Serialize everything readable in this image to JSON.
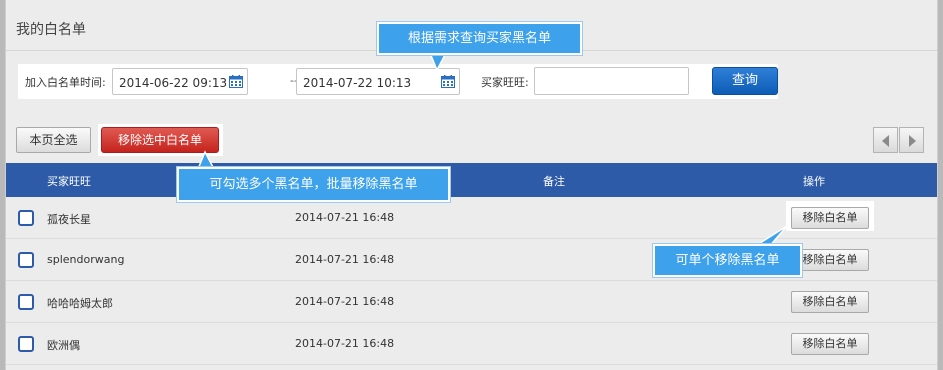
{
  "page_title": "我的白名单",
  "filter": {
    "date_label": "加入白名单时间:",
    "start_date": "2014-06-22 09:13",
    "separator": "--",
    "end_date": "2014-07-22 10:13",
    "buyer_label": "买家旺旺:",
    "buyer_value": "",
    "query_button": "查询"
  },
  "toolbar": {
    "select_all": "本页全选",
    "remove_selected": "移除选中白名单"
  },
  "table": {
    "headers": [
      "买家旺旺",
      "备注",
      "操作"
    ],
    "rows": [
      {
        "name": "孤夜长星",
        "time": "2014-07-21 16:48",
        "action": "移除白名单"
      },
      {
        "name": "splendorwang",
        "time": "2014-07-21 16:48",
        "action": "移除白名单"
      },
      {
        "name": "哈哈哈姆太郎",
        "time": "2014-07-21 16:48",
        "action": "移除白名单"
      },
      {
        "name": "欧洲偶",
        "time": "2014-07-21 16:48",
        "action": "移除白名单"
      }
    ]
  },
  "callouts": {
    "query_hint": "根据需求查询买家黑名单",
    "batch_hint": "可勾选多个黑名单，批量移除黑名单",
    "single_hint": "可单个移除黑名单"
  },
  "colors": {
    "header_blue": "#2d5ba8",
    "callout_blue": "#3ea1ec",
    "remove_red": "#d13a33",
    "query_blue": "#1a6bc6"
  },
  "icons": [
    "calendar-icon",
    "chevron-left-icon",
    "chevron-right-icon",
    "checkbox-icon"
  ]
}
